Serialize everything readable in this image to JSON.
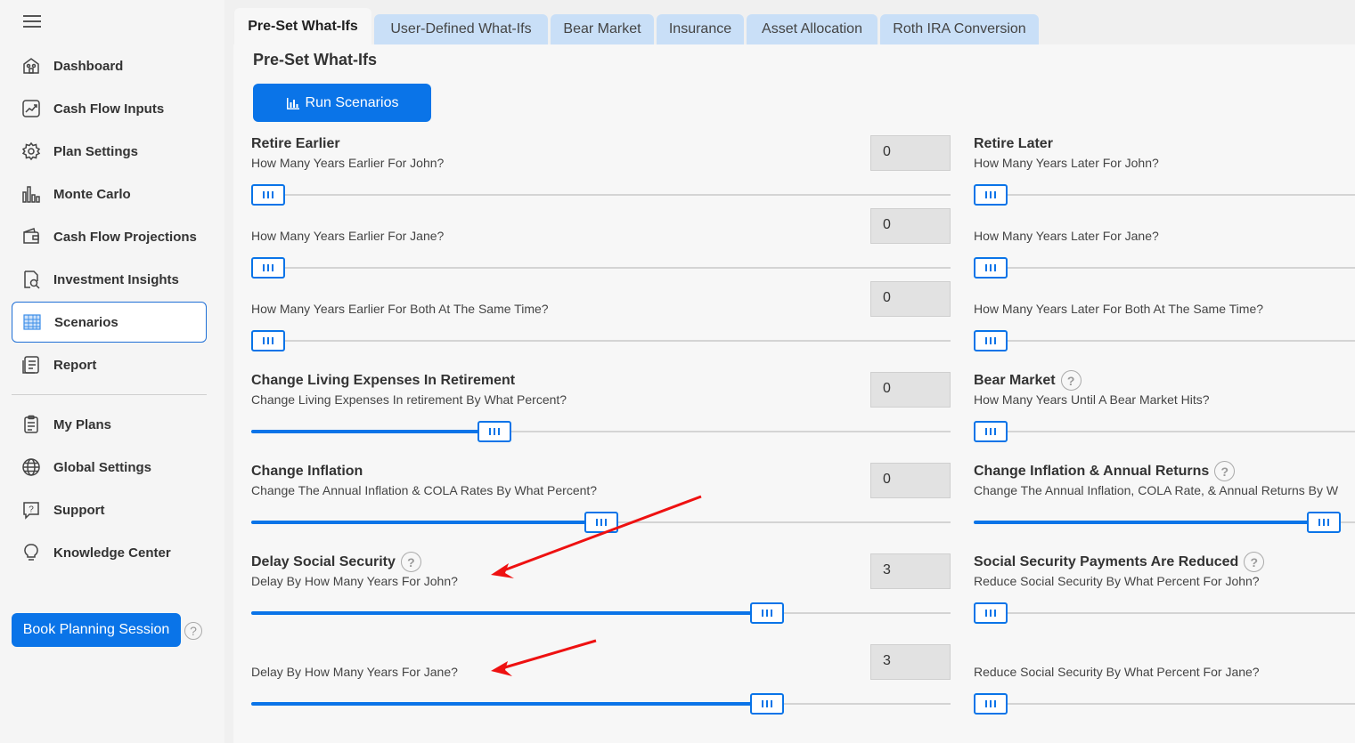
{
  "sidebar": {
    "items": [
      {
        "label": "Dashboard",
        "icon": "dashboard-icon"
      },
      {
        "label": "Cash Flow Inputs",
        "icon": "cash-flow-inputs-icon"
      },
      {
        "label": "Plan Settings",
        "icon": "gear-icon"
      },
      {
        "label": "Monte Carlo",
        "icon": "bar-chart-icon"
      },
      {
        "label": "Cash Flow Projections",
        "icon": "wallet-icon"
      },
      {
        "label": "Investment Insights",
        "icon": "document-search-icon"
      },
      {
        "label": "Scenarios",
        "icon": "scenarios-icon",
        "active": true
      },
      {
        "label": "Report",
        "icon": "report-icon"
      },
      {
        "label": "My Plans",
        "icon": "clipboard-icon"
      },
      {
        "label": "Global Settings",
        "icon": "globe-icon"
      },
      {
        "label": "Support",
        "icon": "help-chat-icon"
      },
      {
        "label": "Knowledge Center",
        "icon": "lightbulb-icon"
      }
    ],
    "book_label": "Book Planning Session"
  },
  "tabs": [
    "Pre-Set What-Ifs",
    "User-Defined What-Ifs",
    "Bear Market",
    "Insurance",
    "Asset Allocation",
    "Roth IRA Conversion"
  ],
  "main": {
    "title": "Pre-Set What-Ifs",
    "run_label": "Run Scenarios",
    "accent_color": "#0a74e8",
    "left": {
      "retire_earlier": {
        "heading": "Retire Earlier",
        "john": {
          "label": "How Many Years Earlier For John?",
          "value": "0",
          "level": 0
        },
        "jane": {
          "label": "How Many Years Earlier For Jane?",
          "value": "0",
          "level": 0
        },
        "both": {
          "label": "How Many Years Earlier For Both At The Same Time?",
          "value": "0",
          "level": 0
        }
      },
      "living_expenses": {
        "heading": "Change Living Expenses In Retirement",
        "label": "Change Living Expenses In retirement By What Percent?",
        "value": "0",
        "level": 0.34
      },
      "inflation": {
        "heading": "Change Inflation",
        "label": "Change The Annual Inflation & COLA Rates By What Percent?",
        "value": "0",
        "level": 0.5
      },
      "delay_ss": {
        "heading": "Delay Social Security",
        "john": {
          "label": "Delay By How Many Years For John?",
          "value": "3",
          "level": 0.75
        },
        "jane": {
          "label": "Delay By How Many Years For Jane?",
          "value": "3",
          "level": 0.75
        }
      }
    },
    "right": {
      "retire_later": {
        "heading": "Retire Later",
        "john": {
          "label": "How Many Years Later For John?"
        },
        "jane": {
          "label": "How Many Years Later For Jane?"
        },
        "both": {
          "label": "How Many Years Later For Both At The Same Time?"
        }
      },
      "bear_market": {
        "heading": "Bear Market",
        "label": "How Many Years Until A Bear Market Hits?"
      },
      "inflation_returns": {
        "heading": "Change Inflation & Annual Returns",
        "label": "Change The Annual Inflation, COLA Rate, & Annual Returns By W"
      },
      "ss_reduced": {
        "heading": "Social Security Payments Are Reduced",
        "john": {
          "label": "Reduce Social Security By What Percent For John?"
        },
        "jane": {
          "label": "Reduce Social Security By What Percent For Jane?"
        }
      }
    }
  }
}
